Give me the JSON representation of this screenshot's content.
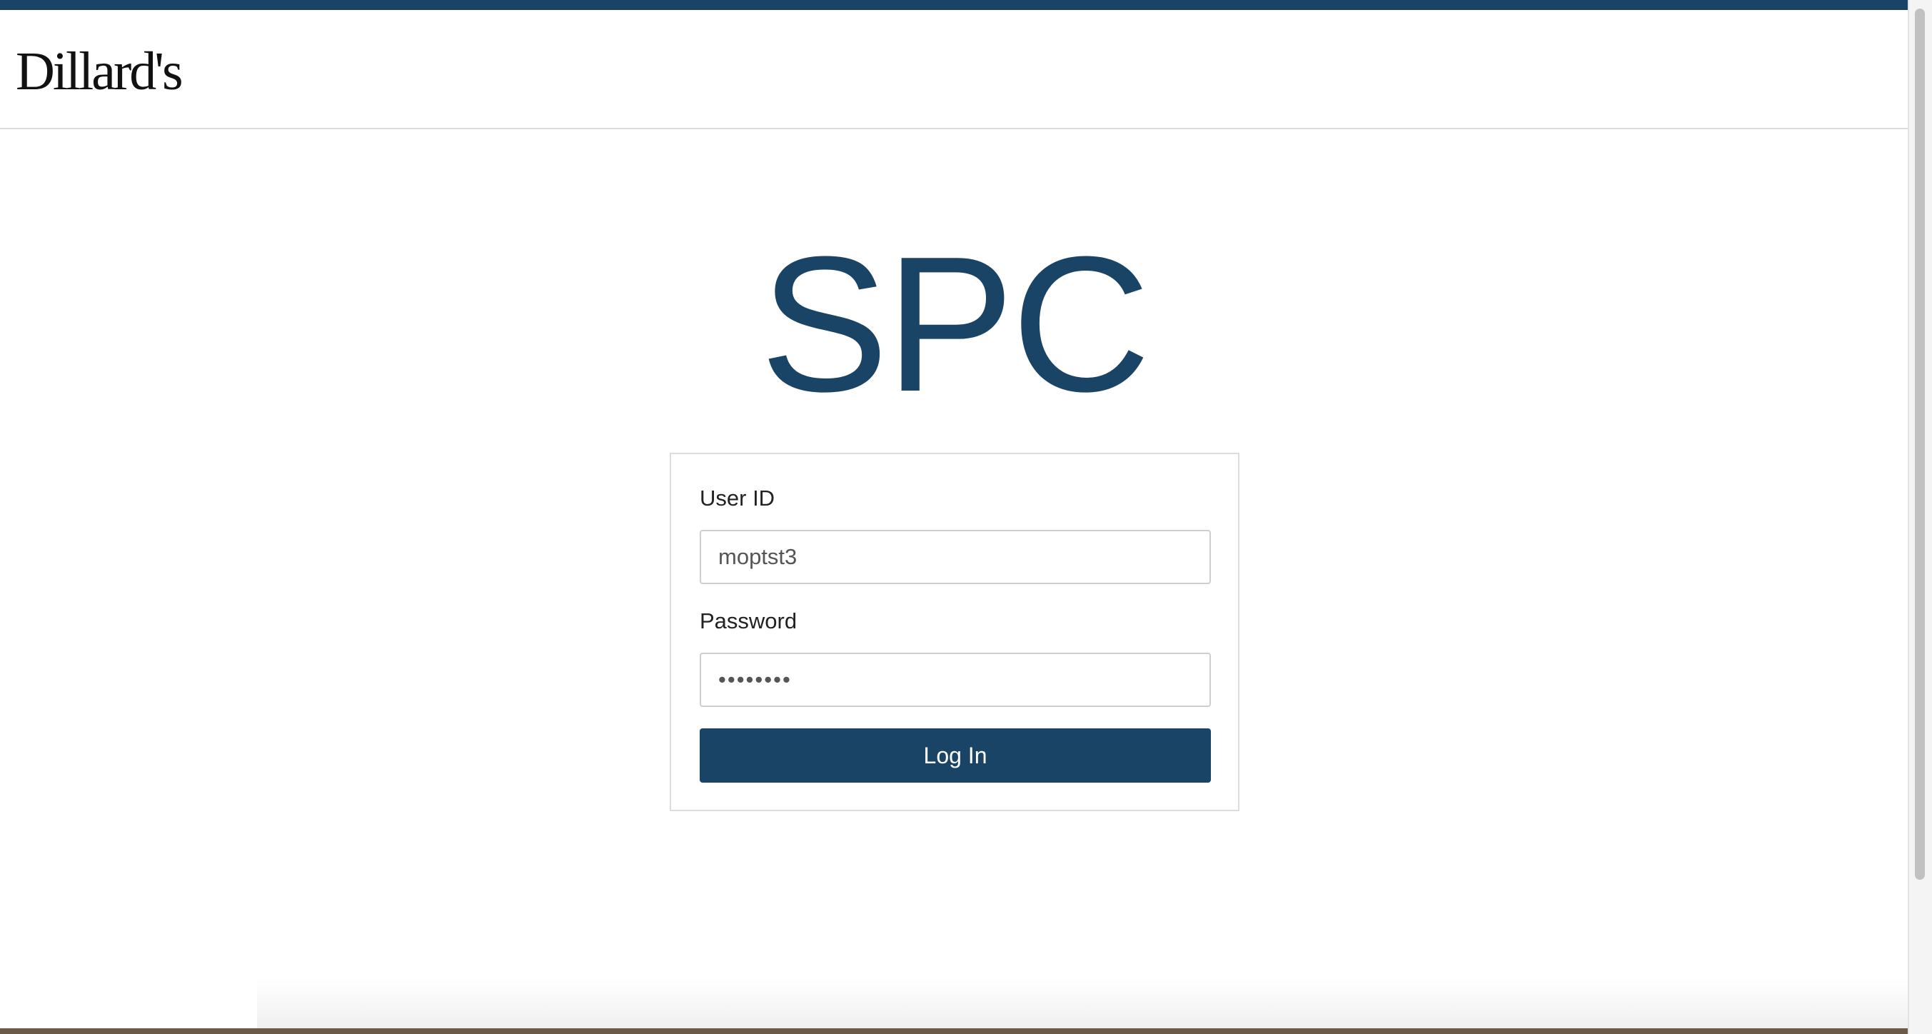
{
  "header": {
    "logo_text": "Dillard's"
  },
  "app": {
    "title": "SPC"
  },
  "login_form": {
    "user_id_label": "User ID",
    "user_id_value": "moptst3",
    "password_label": "Password",
    "password_value": "••••••••",
    "login_button_label": "Log In"
  },
  "colors": {
    "brand_navy": "#1a4466",
    "border_gray": "#dddddd",
    "background": "#ffffff"
  }
}
